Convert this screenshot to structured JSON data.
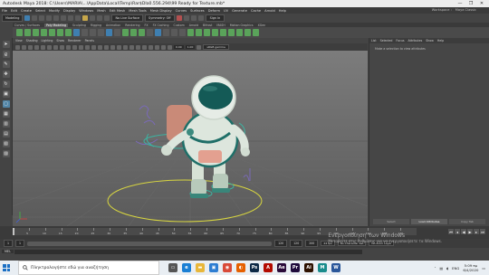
{
  "window": {
    "title": "Autodesk Maya 2018: C:\\Users\\MARIA\\...\\AppData\\Local\\Temp\\Rar$DIa0.556.294\\99 Ready for Texture.mb*",
    "controls": [
      "—",
      "❐",
      "✕"
    ]
  },
  "menubar": [
    "File",
    "Edit",
    "Create",
    "Select",
    "Modify",
    "Display",
    "Windows",
    "Mesh",
    "Edit Mesh",
    "Mesh Tools",
    "Mesh Display",
    "Curves",
    "Surfaces",
    "Deform",
    "UV",
    "Generate",
    "Cache",
    "Arnold",
    "Help"
  ],
  "menubar_right": [
    "Workspace :",
    "Maya Classic"
  ],
  "status_line": {
    "mode": "Modeling",
    "no_live": "No Live Surface",
    "symmetry": "Symmetry: Off",
    "sign_in": "Sign In"
  },
  "shelf_tabs": [
    "Curves / Surfaces",
    "Poly Modeling",
    "Sculpting",
    "Rigging",
    "Animation",
    "Rendering",
    "FX",
    "FX Caching",
    "Custom",
    "Arnold",
    "Bifrost",
    "MASH",
    "Motion Graphics",
    "XGen"
  ],
  "shelf_active": "Poly Modeling",
  "viewport": {
    "menu": [
      "View",
      "Shading",
      "Lighting",
      "Show",
      "Renderer",
      "Panels"
    ],
    "camera_near": "0.00",
    "camera_far": "1.00",
    "color_space": "sRGB gamma"
  },
  "side_panel": {
    "tabs": [
      "List",
      "Selected",
      "Focus",
      "Attributes",
      "Show",
      "Help"
    ],
    "message": "Make a selection to view attributes",
    "buttons": [
      "Select",
      "Load Attributes",
      "Copy Tab"
    ]
  },
  "timeline": {
    "ticks": [
      "5",
      "10",
      "15",
      "20",
      "25",
      "30",
      "35",
      "40",
      "45",
      "50",
      "55",
      "60",
      "65",
      "70",
      "75",
      "80",
      "85",
      "90",
      "95",
      "100",
      "105",
      "110",
      "115",
      "120"
    ],
    "current": "1"
  },
  "range": {
    "start": "1",
    "start2": "1",
    "end": "120",
    "end2": "120",
    "end3": "200",
    "fps": "24 fps",
    "char_set": "No Character Set",
    "anim_layer": "No Anim Layer"
  },
  "command_line": {
    "label": "MEL"
  },
  "watermark": {
    "line1": "Ενεργοποίηση των Windows",
    "line2": "Μεταβείτε στις Ρυθμίσεις για να ενεργοποιήσετε τα Windows."
  },
  "taskbar": {
    "search_placeholder": "Πληκτρολογήστε εδώ για αναζήτηση",
    "apps": [
      {
        "name": "task-view",
        "color": "#555555",
        "glyph": "▭"
      },
      {
        "name": "edge",
        "color": "#1a7fd4",
        "glyph": "e"
      },
      {
        "name": "file-explorer",
        "color": "#e8b73a",
        "glyph": "▬"
      },
      {
        "name": "store",
        "color": "#2d7dd2",
        "glyph": "▣"
      },
      {
        "name": "chrome",
        "color": "#d94a38",
        "glyph": "◉"
      },
      {
        "name": "firefox",
        "color": "#e66000",
        "glyph": "◐"
      },
      {
        "name": "photoshop",
        "color": "#0e2a47",
        "glyph": "Ps"
      },
      {
        "name": "acrobat",
        "color": "#b30b00",
        "glyph": "A"
      },
      {
        "name": "after-effects",
        "color": "#2a0b3a",
        "glyph": "Ae"
      },
      {
        "name": "premiere",
        "color": "#1e0a3c",
        "glyph": "Pr"
      },
      {
        "name": "illustrator",
        "color": "#2d1100",
        "glyph": "Ai"
      },
      {
        "name": "maya",
        "color": "#1a8c8c",
        "glyph": "M"
      },
      {
        "name": "word",
        "color": "#2b579a",
        "glyph": "W"
      }
    ],
    "lang": "ENG",
    "time": "5:09 πμ",
    "date": "6/4/2020"
  }
}
